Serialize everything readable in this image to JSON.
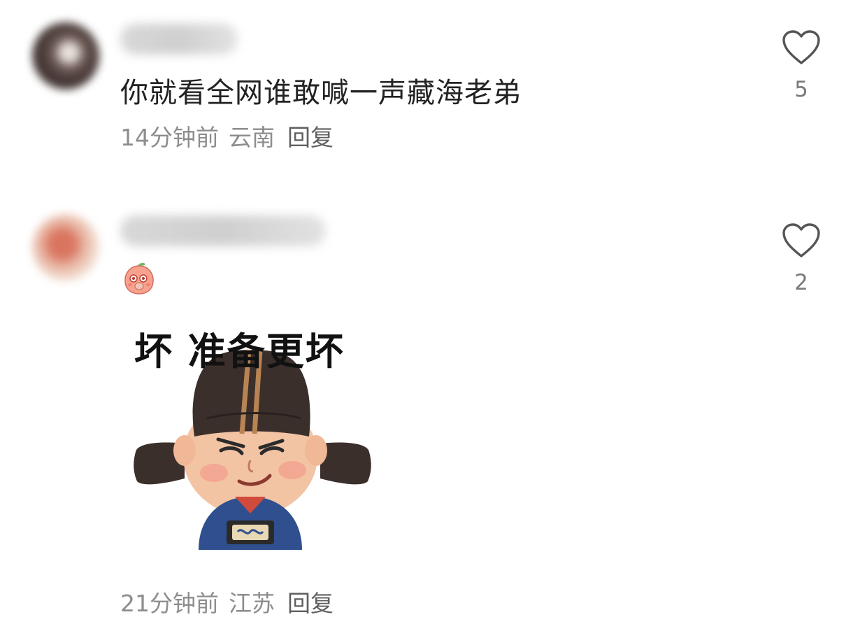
{
  "comments": [
    {
      "text": "你就看全网谁敢喊一声藏海老弟",
      "time": "14分钟前",
      "location": "云南",
      "reply_label": "回复",
      "likes": "5"
    },
    {
      "emoji": "peach-shy-emoji",
      "sticker_caption": "坏   准备更坏",
      "time": "21分钟前",
      "location": "江苏",
      "reply_label": "回复",
      "likes": "2"
    }
  ],
  "colors": {
    "text": "#222222",
    "meta": "#8d8d8d",
    "reply": "#5f5f5f",
    "like_outline": "#555555"
  }
}
